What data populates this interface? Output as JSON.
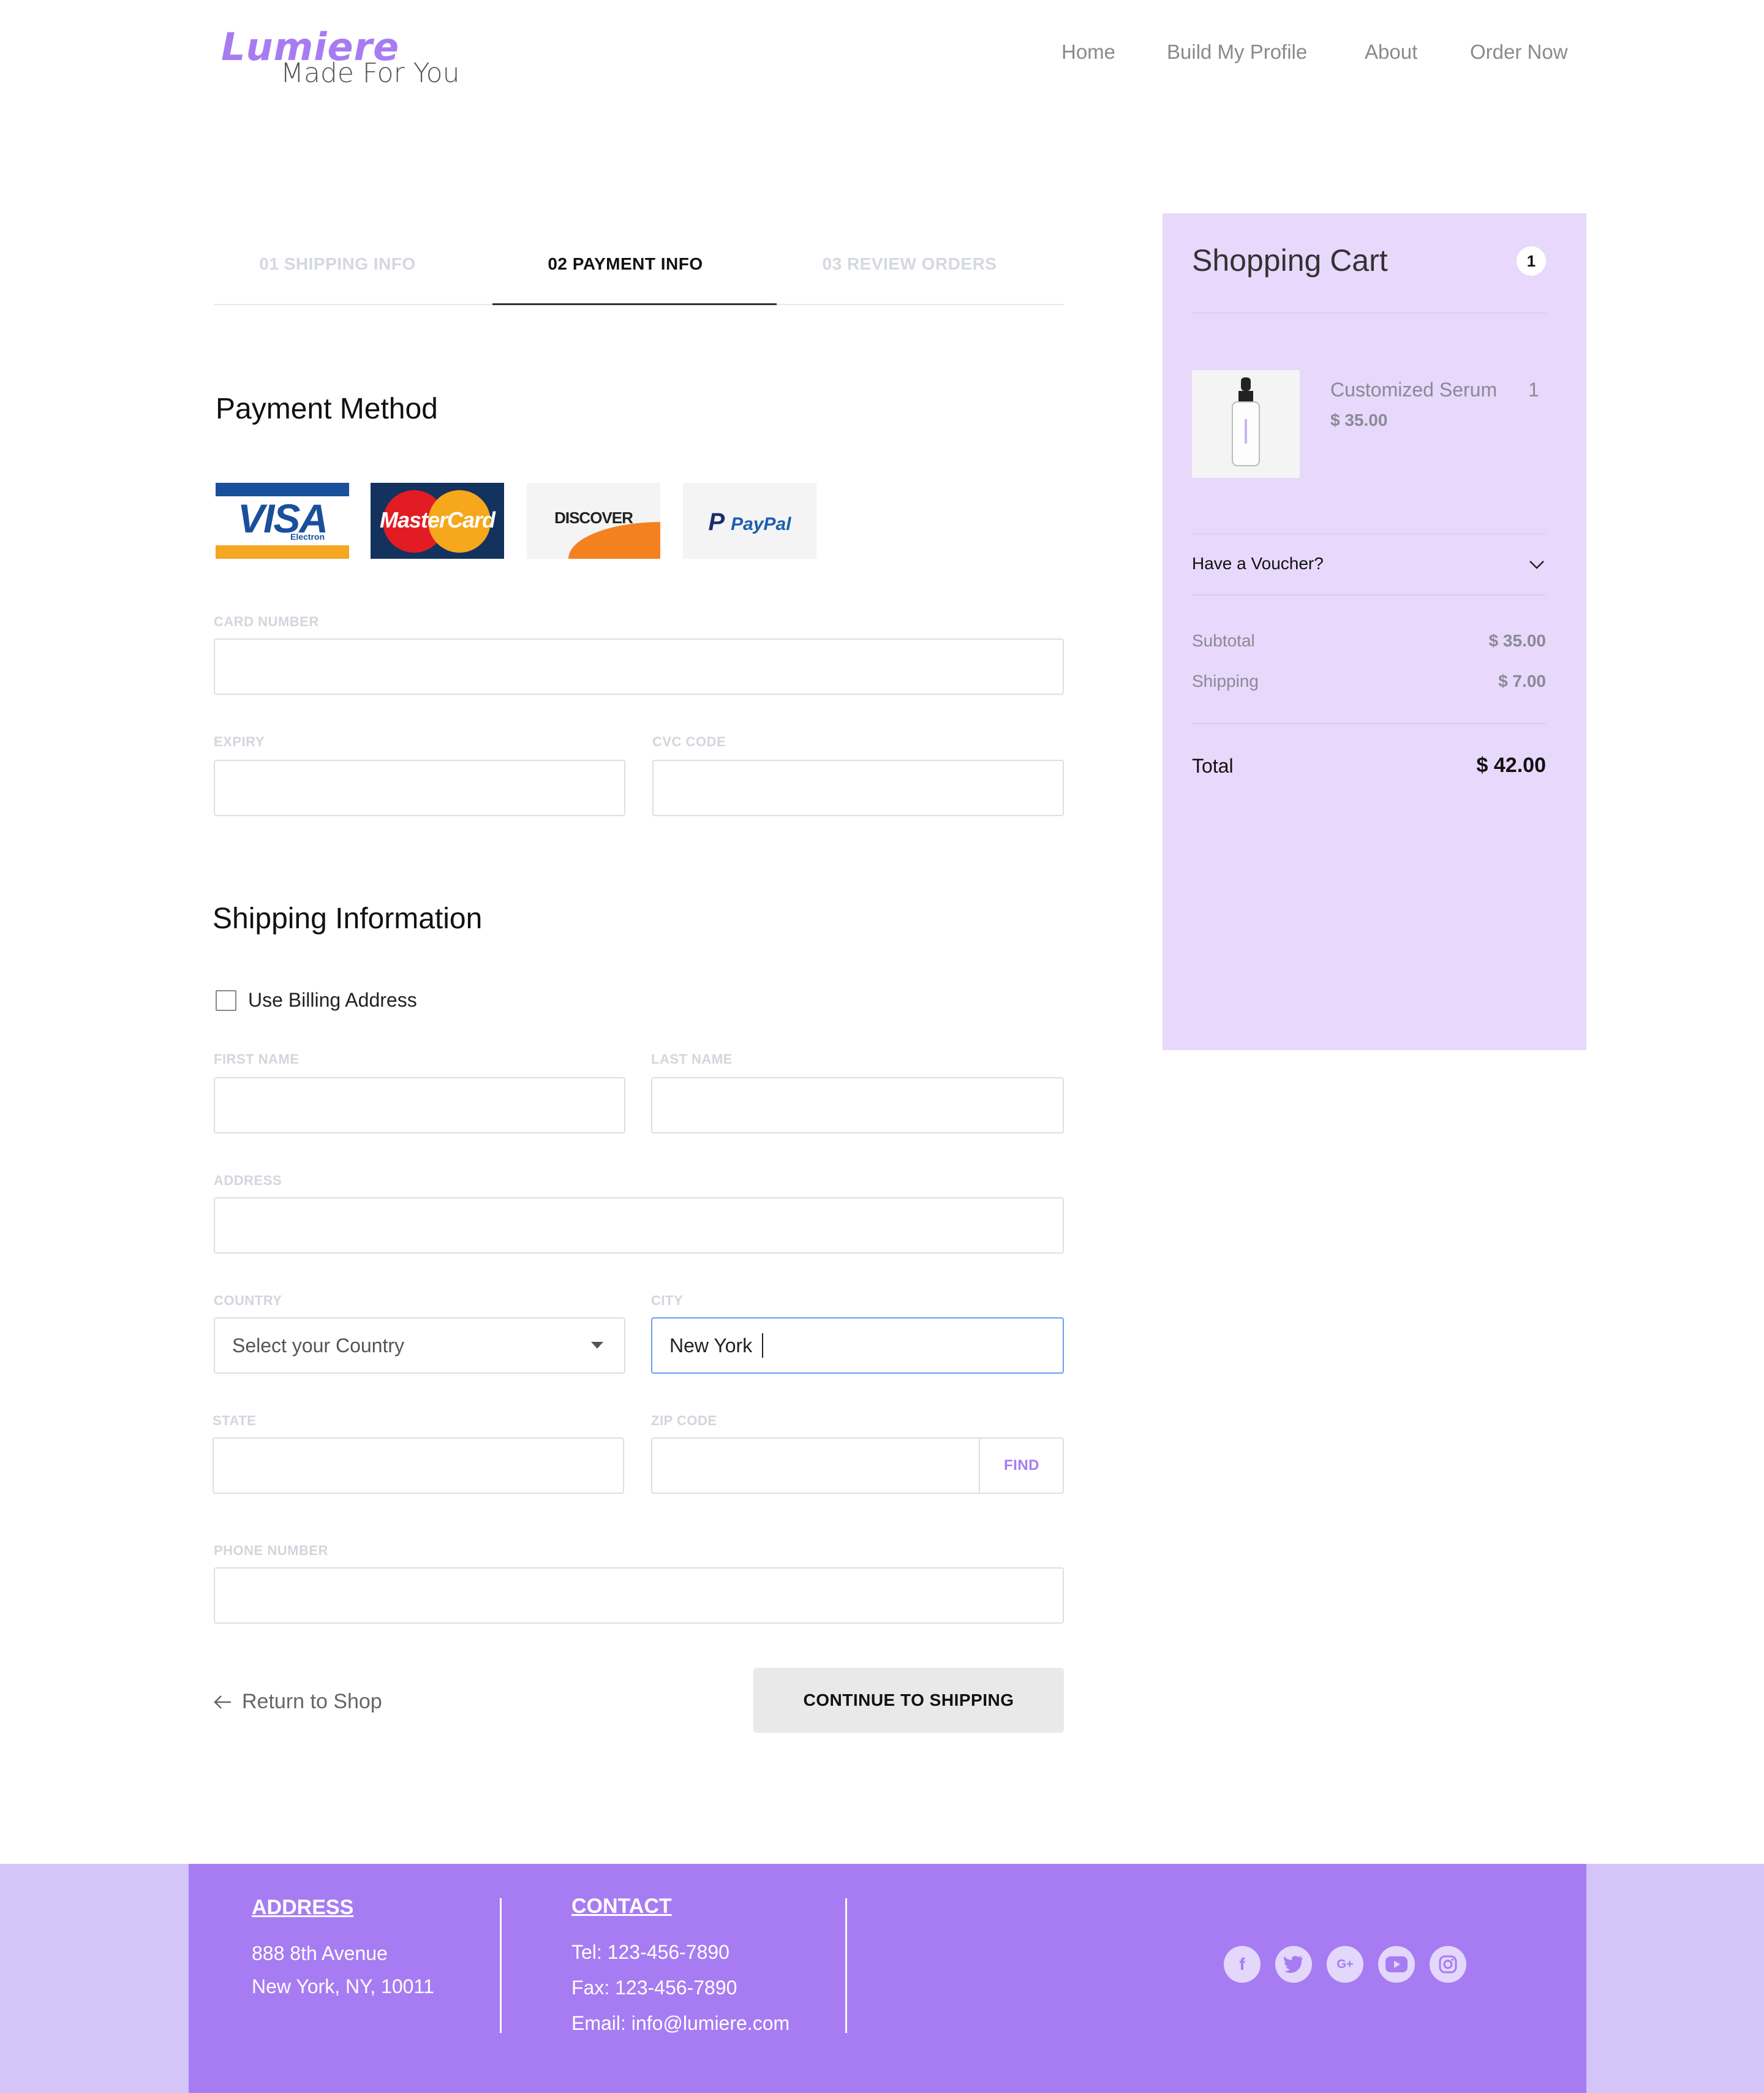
{
  "brand": {
    "name": "Lumiere",
    "tagline": "Made For You",
    "accent": "#a77cf2"
  },
  "nav": {
    "items": [
      "Home",
      "Build My Profile",
      "About",
      "Order Now"
    ]
  },
  "steps": [
    {
      "label": "01 SHIPPING INFO",
      "state": "inactive"
    },
    {
      "label": "02 PAYMENT INFO",
      "state": "active"
    },
    {
      "label": "03 REVIEW ORDERS",
      "state": "inactive"
    }
  ],
  "payment": {
    "title": "Payment Method",
    "cards": [
      {
        "name": "visa-card",
        "text": "VISA",
        "sub": "Electron"
      },
      {
        "name": "mastercard-card",
        "text": "MasterCard"
      },
      {
        "name": "discover-card",
        "text": "DISCOVER"
      },
      {
        "name": "paypal-card",
        "text": "PayPal"
      }
    ],
    "card_number_label": "CARD NUMBER",
    "expiry_label": "EXPIRY",
    "cvc_label": "CVC CODE"
  },
  "shipping": {
    "title": "Shipping Information",
    "use_billing_label": "Use Billing Address",
    "use_billing_checked": false,
    "first_name_label": "FIRST NAME",
    "last_name_label": "LAST NAME",
    "address_label": "ADDRESS",
    "country_label": "COUNTRY",
    "country_placeholder": "Select your Country",
    "city_label": "CITY",
    "city_value": "New York",
    "state_label": "STATE",
    "zip_label": "ZIP CODE",
    "find_label": "FIND",
    "phone_label": "PHONE NUMBER"
  },
  "actions": {
    "return_label": "Return to Shop",
    "continue_label": "CONTINUE TO SHIPPING"
  },
  "cart": {
    "title": "Shopping Cart",
    "count": "1",
    "item": {
      "name": "Customized Serum",
      "qty": "1",
      "price": "$ 35.00"
    },
    "voucher_label": "Have a Voucher?",
    "subtotal_label": "Subtotal",
    "subtotal_value": "$ 35.00",
    "shipping_label": "Shipping",
    "shipping_value": "$ 7.00",
    "total_label": "Total",
    "total_value": "$ 42.00",
    "bg_color": "#e8d8fb"
  },
  "footer": {
    "address_head": "ADDRESS",
    "address_line1": "888 8th Avenue",
    "address_line2": "New York, NY, 10011",
    "contact_head": "CONTACT",
    "tel": "Tel: 123-456-7890",
    "fax": "Fax: 123-456-7890",
    "email": "Email: info@lumiere.com",
    "social": [
      "facebook-icon",
      "twitter-icon",
      "google-plus-icon",
      "youtube-icon",
      "instagram-icon"
    ]
  }
}
